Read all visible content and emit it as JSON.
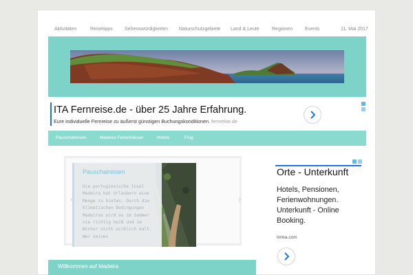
{
  "top_nav": {
    "items": [
      "Aktivitäten",
      "Reisetipps",
      "Sehenswürdigkeiten",
      "Naturschutzgebiete",
      "Land & Leute",
      "Regionen",
      "Events"
    ],
    "date": "11. Mai 2017"
  },
  "ad_banner": {
    "title": "ITA Fernreise.de - über 25 Jahre Erfahrung.",
    "description": "Eure individuelle Fernreise zu äußerst günstigen Buchungskonditionen.",
    "domain": "fernreise.de"
  },
  "sub_nav": {
    "items": [
      "Pauschalreisen",
      "Madeira Ferienhäuser",
      "Hotels",
      "Flug"
    ]
  },
  "slider": {
    "title": "Pauschalreisen",
    "body": "Die portugiesische Insel Madeira hat Urlaubern eine Menge zu bieten. Durch die klimatischen Bedingungen Madeiras wird es im Sommer nie richtig heiß und im Winter nicht wirklich kalt. Wer seinen"
  },
  "ad_sidebar": {
    "title": "Orte - Unterkunft",
    "description": "Hotels, Pensionen, Ferienwohnungen. Unterkunft - Online Booking.",
    "domain": "limba.com"
  },
  "welcome": {
    "heading": "Willkommen auf Madeira"
  },
  "colors": {
    "accent": "#7ed3c8",
    "link_blue": "#1a73e8",
    "page_bg": "#e9e9e6"
  }
}
